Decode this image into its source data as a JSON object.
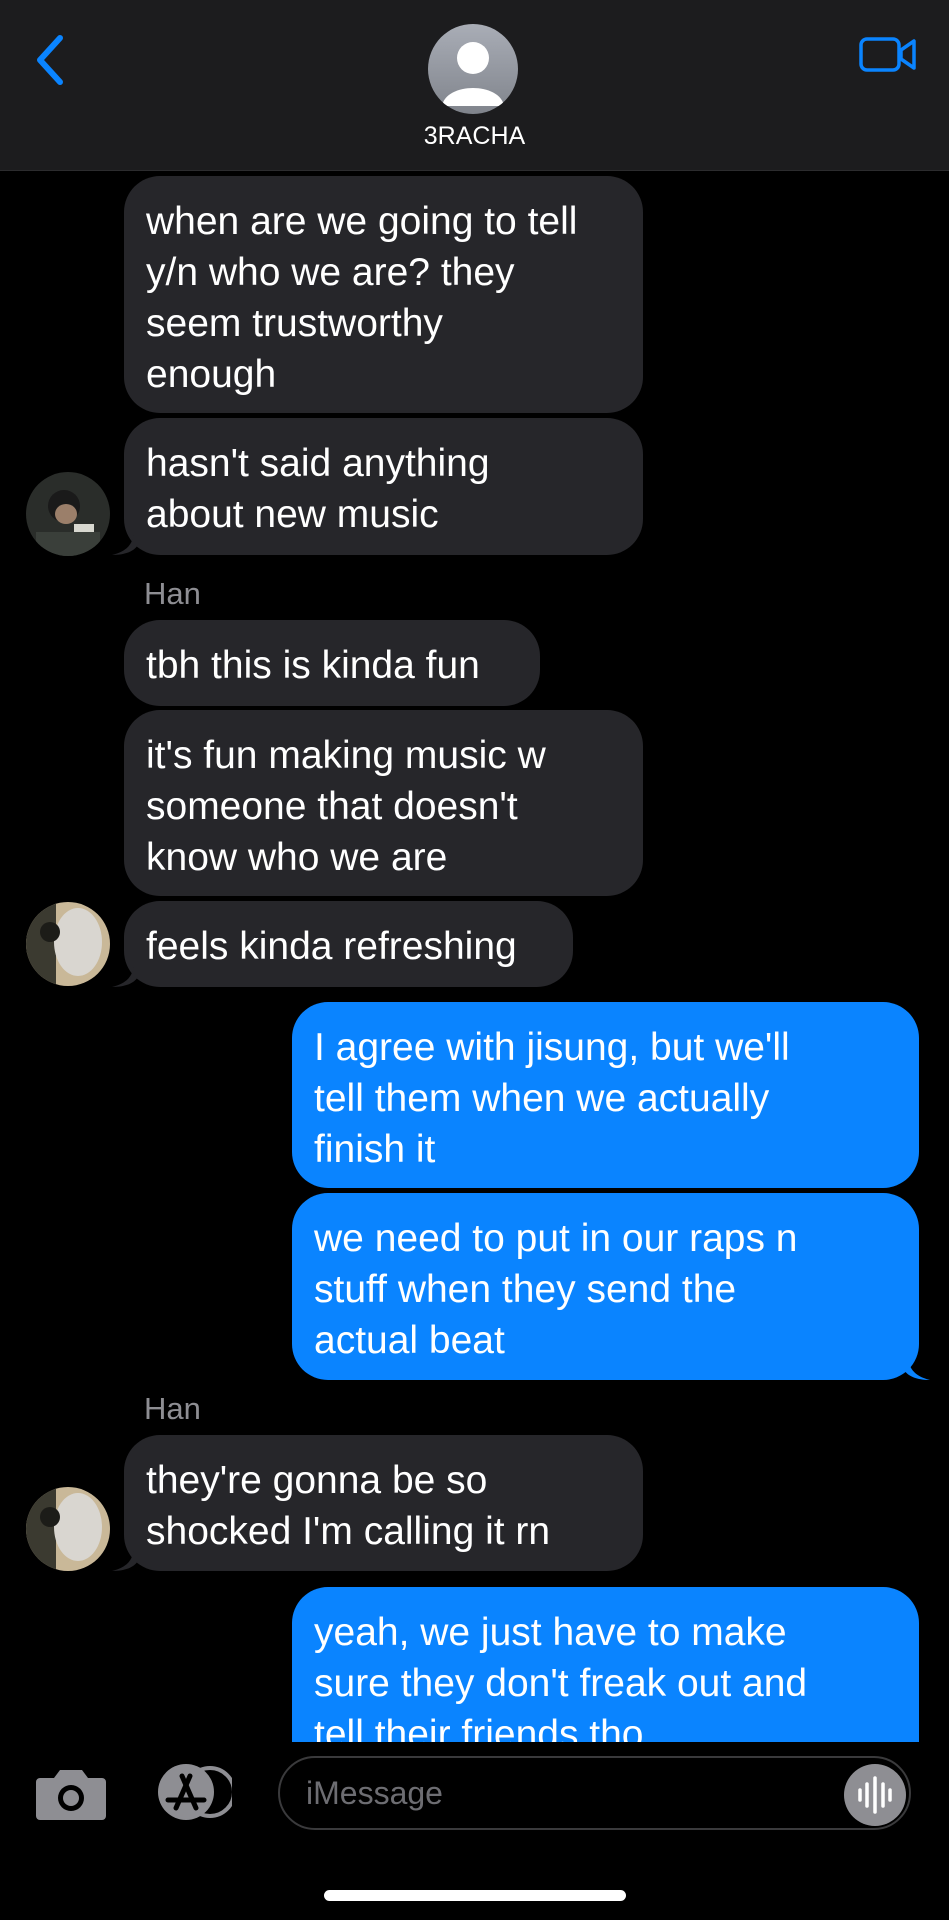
{
  "header": {
    "title": "3RACHA",
    "back_icon": "chevron-left-icon",
    "video_icon": "video-camera-icon",
    "accent": "#0a84ff"
  },
  "messages": [
    {
      "dir": "in",
      "text": "when are we going to tell\ny/n who we are? they\nseem trustworthy\nenough"
    },
    {
      "dir": "in",
      "text": "hasn't said anything\nabout new music"
    },
    {
      "sender": "Han"
    },
    {
      "dir": "in",
      "text": "tbh this is kinda fun"
    },
    {
      "dir": "in",
      "text": "it's fun making music w\nsomeone that doesn't\nknow who we are"
    },
    {
      "dir": "in",
      "text": "feels kinda refreshing"
    },
    {
      "dir": "out",
      "text": "I agree with jisung, but we'll\ntell them when we actually\nfinish it"
    },
    {
      "dir": "out",
      "text": "we need to put in our raps n\nstuff when they send the\nactual beat"
    },
    {
      "sender": "Han"
    },
    {
      "dir": "in",
      "text": "they're gonna be so\nshocked I'm calling it rn"
    },
    {
      "dir": "out",
      "text": "yeah, we just have to make\nsure they don't freak out and\ntell their friends tho"
    }
  ],
  "composer": {
    "placeholder": "iMessage",
    "camera_icon": "camera-icon",
    "appstore_icon": "app-store-icon",
    "audio_icon": "audio-waveform-icon"
  },
  "colors": {
    "incoming_bubble": "#26262a",
    "outgoing_bubble": "#0a84ff",
    "header_bg": "#1c1c1e"
  }
}
